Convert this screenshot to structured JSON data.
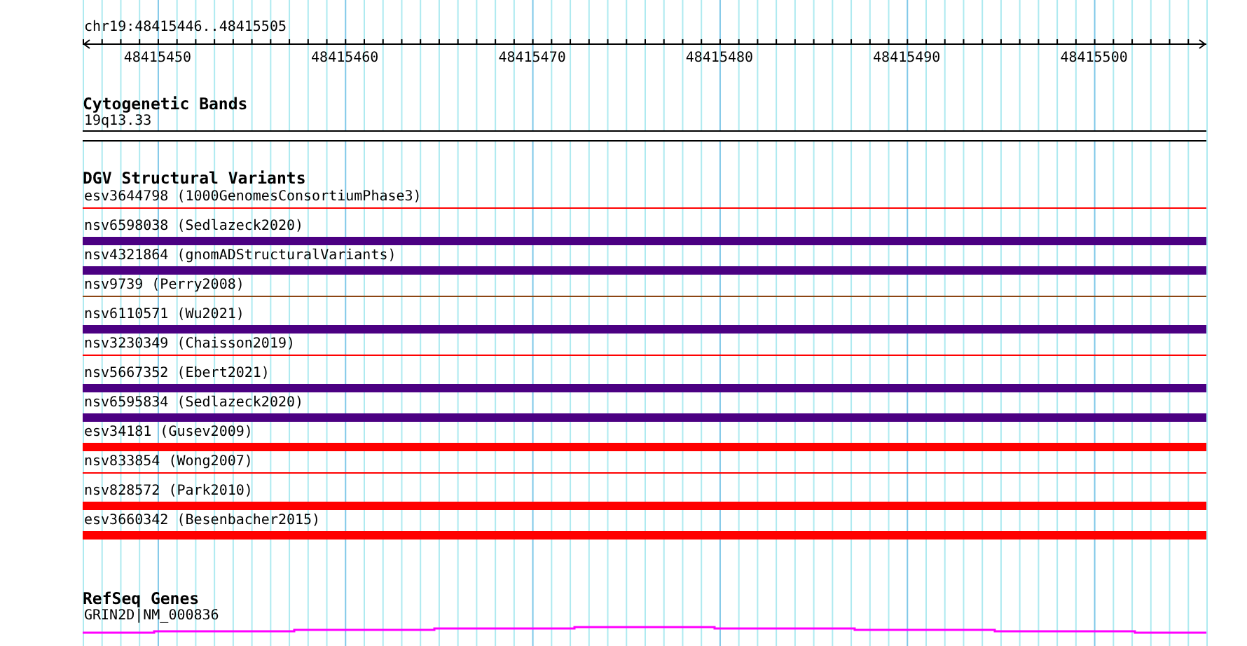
{
  "ruler": {
    "title": "chr19:48415446..48415505",
    "tick_labels": [
      "48415450",
      "48415460",
      "48415470",
      "48415480",
      "48415490",
      "48415500"
    ]
  },
  "cytogenetic_bands": {
    "title": "Cytogenetic Bands",
    "band": "19q13.33"
  },
  "dgv_structural_variants": {
    "title": "DGV Structural Variants",
    "variants": [
      {
        "label": "esv3644798 (1000GenomesConsortiumPhase3)",
        "kind": "thin",
        "color": "#ff0000"
      },
      {
        "label": "nsv6598038 (Sedlazeck2020)",
        "kind": "thick",
        "color": "#4b0082"
      },
      {
        "label": "nsv4321864 (gnomADStructuralVariants)",
        "kind": "thick",
        "color": "#4b0082"
      },
      {
        "label": "nsv9739 (Perry2008)",
        "kind": "thin",
        "color": "#8b4513"
      },
      {
        "label": "nsv6110571 (Wu2021)",
        "kind": "thick",
        "color": "#4b0082"
      },
      {
        "label": "nsv3230349 (Chaisson2019)",
        "kind": "thin",
        "color": "#ff0000"
      },
      {
        "label": "nsv5667352 (Ebert2021)",
        "kind": "thick",
        "color": "#4b0082"
      },
      {
        "label": "nsv6595834 (Sedlazeck2020)",
        "kind": "thick",
        "color": "#4b0082"
      },
      {
        "label": "esv34181 (Gusev2009)",
        "kind": "thick",
        "color": "#ff0000"
      },
      {
        "label": "nsv833854 (Wong2007)",
        "kind": "thin",
        "color": "#ff0000"
      },
      {
        "label": "nsv828572 (Park2010)",
        "kind": "thick",
        "color": "#ff0000"
      },
      {
        "label": "esv3660342 (Besenbacher2015)",
        "kind": "thick",
        "color": "#ff0000"
      }
    ]
  },
  "refseq_genes": {
    "title": "RefSeq Genes",
    "gene": "GRIN2D|NM_000836"
  }
}
